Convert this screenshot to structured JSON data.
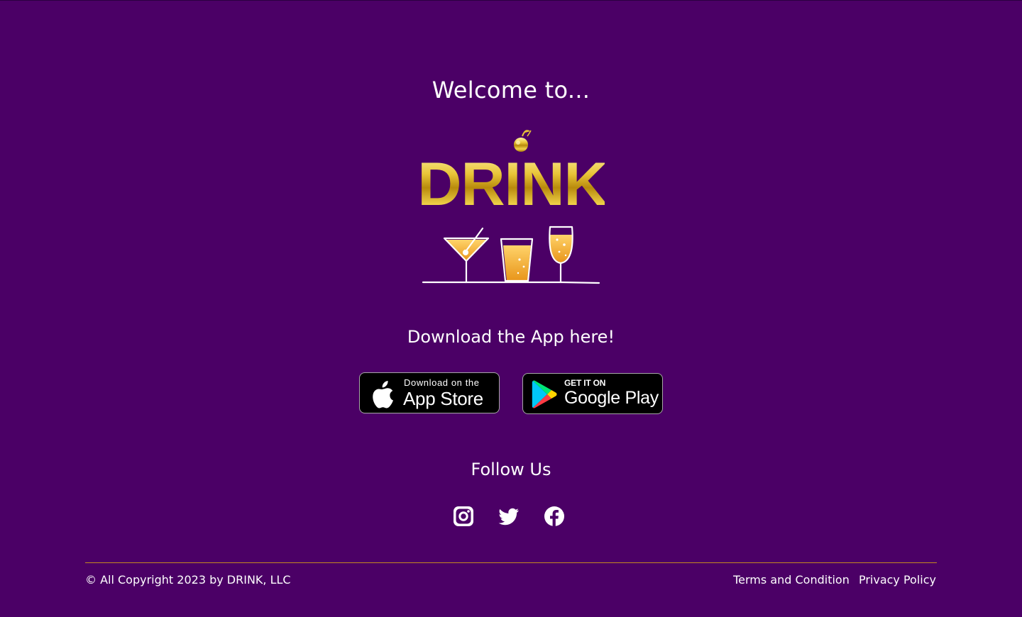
{
  "colors": {
    "background": "#4b0066",
    "gold": "#d4a017",
    "divider": "#c58a1f",
    "text": "#ffffff"
  },
  "hero": {
    "welcome": "Welcome to...",
    "logo_text": "DRINK",
    "logo_icons": [
      "cherry-icon",
      "martini-glass-icon",
      "highball-glass-icon",
      "wine-glass-icon"
    ]
  },
  "download": {
    "title": "Download the App here!",
    "app_store": {
      "small_label": "Download on the",
      "big_label": "App Store",
      "icon": "apple-icon"
    },
    "google_play": {
      "small_label": "GET IT ON",
      "big_label": "Google Play",
      "icon": "google-play-icon"
    }
  },
  "social": {
    "title": "Follow Us",
    "links": [
      {
        "name": "Instagram",
        "icon": "instagram-icon"
      },
      {
        "name": "Twitter",
        "icon": "twitter-icon"
      },
      {
        "name": "Facebook",
        "icon": "facebook-icon"
      }
    ]
  },
  "footer": {
    "copyright": "© All Copyright 2023 by DRINK, LLC",
    "terms": "Terms and Condition",
    "privacy": "Privacy Policy"
  }
}
